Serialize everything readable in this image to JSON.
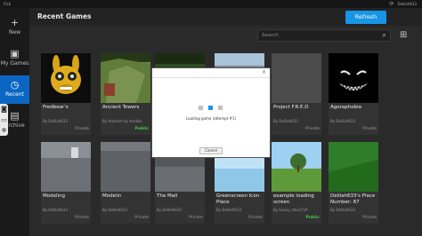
{
  "window": {
    "menu_file": "FILE",
    "username": "Delilah633",
    "sync_icon": "sync-icon"
  },
  "sidebar": {
    "items": [
      {
        "label": "New",
        "icon": "+"
      },
      {
        "label": "My Games",
        "icon": "▣"
      },
      {
        "label": "Recent",
        "icon": "◷"
      },
      {
        "label": "Archive",
        "icon": "▤"
      }
    ]
  },
  "header": {
    "title": "Recent Games",
    "refresh_label": "Refresh"
  },
  "search": {
    "placeholder": "Search"
  },
  "games": [
    {
      "name": "Fredbear's",
      "by": "By Delilah633",
      "status": "Private"
    },
    {
      "name": "Ancient Towers",
      "by": "By Hamlich by studios",
      "status": "Public"
    },
    {
      "name": "",
      "by": "",
      "status": ""
    },
    {
      "name": "",
      "by": "",
      "status": ""
    },
    {
      "name": "Project F.R.E.D",
      "by": "By Delilah633",
      "status": "Private"
    },
    {
      "name": "Agoraphobia",
      "by": "By Delilah633",
      "status": "Private"
    },
    {
      "name": "Modeling",
      "by": "By Delilah633",
      "status": "Private"
    },
    {
      "name": "Modelin",
      "by": "By Delilah633",
      "status": "Private"
    },
    {
      "name": "The Mall",
      "by": "By Delilah633",
      "status": "Private"
    },
    {
      "name": "Greenscreen Icon Place",
      "by": "By Delilah633",
      "status": "Private"
    },
    {
      "name": "example loading screen",
      "by": "By Evazu_alex27cR",
      "status": "Public"
    },
    {
      "name": "Delilah633's Place Number: 87",
      "by": "By Delilah633",
      "status": "Private"
    }
  ],
  "dialog": {
    "message": "Loading game (attempt #1)",
    "cancel_label": "Cancel",
    "close": "×"
  }
}
